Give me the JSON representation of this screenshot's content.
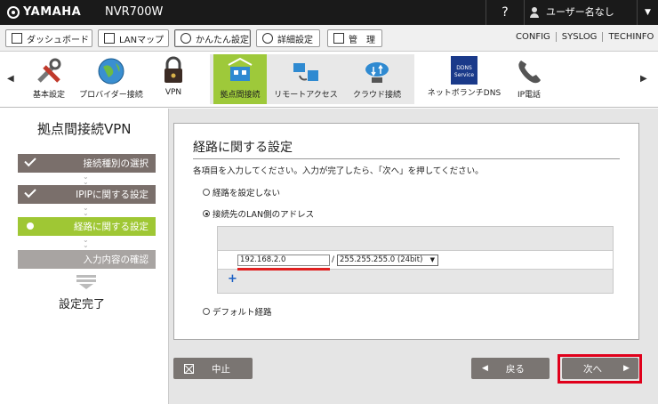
{
  "topbar": {
    "brand": "YAMAHA",
    "model": "NVR700W",
    "help": "?",
    "user": "ユーザー名なし"
  },
  "menu": {
    "items": [
      {
        "label": "ダッシュボード"
      },
      {
        "label": "LANマップ"
      },
      {
        "label": "かんたん設定"
      },
      {
        "label": "詳細設定"
      },
      {
        "label": "管　理"
      }
    ],
    "links": [
      "CONFIG",
      "SYSLOG",
      "TECHINFO"
    ]
  },
  "nav": [
    {
      "label": "基本設定",
      "icon": "wrench-screwdriver-icon"
    },
    {
      "label": "プロバイダー接続",
      "icon": "globe-icon"
    },
    {
      "label": "VPN",
      "icon": "vpn-lock-icon"
    },
    {
      "label": "拠点間接続",
      "icon": "site-connection-icon"
    },
    {
      "label": "リモートアクセス",
      "icon": "remote-access-icon"
    },
    {
      "label": "クラウド接続",
      "icon": "cloud-icon"
    },
    {
      "label": "ネットボランチDNS",
      "icon": "ddns-icon",
      "badge": "DDNS Service"
    },
    {
      "label": "IP電話",
      "icon": "phone-icon"
    }
  ],
  "sidebar": {
    "title": "拠点間接続VPN",
    "steps": [
      {
        "label": "接続種別の選択"
      },
      {
        "label": "IPIPに関する設定"
      },
      {
        "label": "経路に関する設定"
      },
      {
        "label": "入力内容の確認"
      }
    ],
    "done": "設定完了"
  },
  "panel": {
    "title": "経路に関する設定",
    "desc": "各項目を入力してください。入力が完了したら、「次へ」を押してください。",
    "opt_none": "経路を設定しない",
    "opt_lan": "接続先のLAN側のアドレス",
    "ip": "192.168.2.0",
    "slash": "/",
    "mask": "255.255.255.0 (24bit)",
    "opt_default": "デフォルト経路"
  },
  "buttons": {
    "cancel": "中止",
    "back": "戻る",
    "next": "次へ"
  }
}
